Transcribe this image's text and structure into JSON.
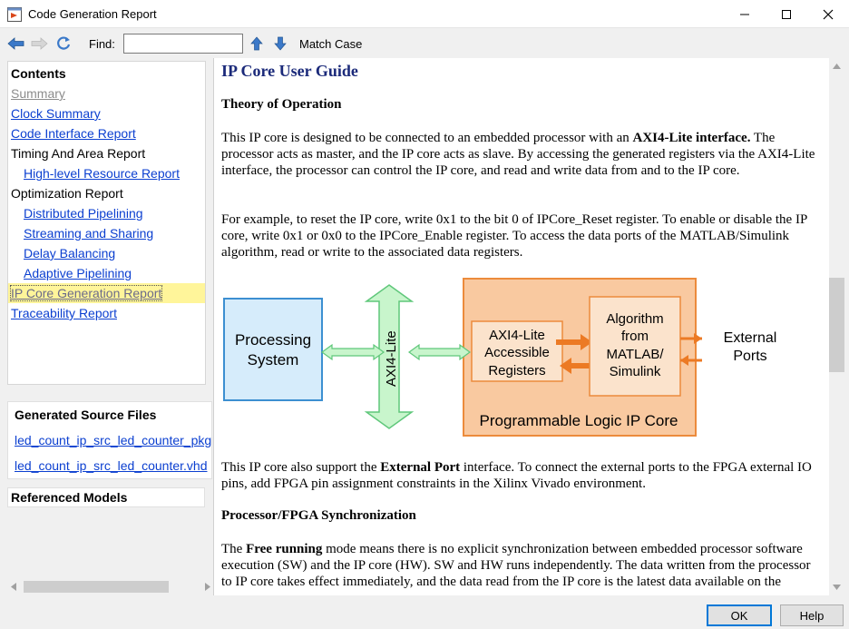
{
  "window": {
    "title": "Code Generation Report",
    "icon": "app-window-icon"
  },
  "toolbar": {
    "back_icon": "back-arrow-icon",
    "forward_icon": "forward-arrow-icon",
    "refresh_icon": "refresh-icon",
    "find_label": "Find:",
    "find_value": "",
    "find_up_icon": "arrow-up-icon",
    "find_down_icon": "arrow-down-icon",
    "match_case_label": "Match Case"
  },
  "contents": {
    "title": "Contents",
    "items": [
      {
        "label": "Summary",
        "style": "gray"
      },
      {
        "label": "Clock Summary",
        "style": "link"
      },
      {
        "label": "Code Interface Report",
        "style": "link"
      },
      {
        "label": "Timing And Area Report",
        "style": "plain"
      },
      {
        "label": "High-level Resource Report",
        "style": "link"
      },
      {
        "label": "Optimization Report",
        "style": "plain"
      },
      {
        "label": "Distributed Pipelining",
        "style": "link"
      },
      {
        "label": "Streaming and Sharing",
        "style": "link"
      },
      {
        "label": "Delay Balancing",
        "style": "link"
      },
      {
        "label": "Adaptive Pipelining",
        "style": "link"
      },
      {
        "label": "IP Core Generation Report",
        "style": "selected"
      },
      {
        "label": "Traceability Report",
        "style": "link"
      }
    ]
  },
  "generated_files": {
    "title": "Generated Source Files",
    "files": [
      "led_count_ip_src_led_counter_pkg.vhd",
      "led_count_ip_src_led_counter.vhd"
    ]
  },
  "referenced_models": {
    "title": "Referenced Models"
  },
  "document": {
    "title": "IP Core User Guide",
    "theory_heading": "Theory of Operation",
    "p1_a": "This IP core is designed to be connected to an embedded processor with an ",
    "p1_b": "AXI4-Lite interface.",
    "p1_c": " The processor acts as master, and the IP core acts as slave. By accessing the generated registers via the AXI4-Lite interface, the processor can control the IP core, and read and write data from and to the IP core.",
    "p2": "For example, to reset the IP core, write 0x1 to the bit 0 of IPCore_Reset register. To enable or disable the IP core, write 0x1 or 0x0 to the IPCore_Enable register. To access the data ports of the MATLAB/Simulink algorithm, read or write to the associated data registers.",
    "p3_a": "This IP core also support the ",
    "p3_b": "External Port",
    "p3_c": " interface. To connect the external ports to the FPGA external IO pins, add FPGA pin assignment constraints in the Xilinx Vivado environment.",
    "sync_heading": "Processor/FPGA Synchronization",
    "p4_a": "The ",
    "p4_b": "Free running",
    "p4_c": " mode means there is no explicit synchronization between embedded processor software execution (SW) and the IP core (HW). SW and HW runs independently. The data written from the processor to IP core takes effect immediately, and the data read from the IP core is the latest data available on the",
    "diagram": {
      "processing_system_line1": "Processing",
      "processing_system_line2": "System",
      "bus_label": "AXI4-Lite",
      "registers_line1": "AXI4-Lite",
      "registers_line2": "Accessible",
      "registers_line3": "Registers",
      "algorithm_line1": "Algorithm",
      "algorithm_line2": "from",
      "algorithm_line3": "MATLAB/",
      "algorithm_line4": "Simulink",
      "external_line1": "External",
      "external_line2": "Ports",
      "ip_core_label": "Programmable Logic IP Core",
      "colors": {
        "processing_fill": "#d6ecfb",
        "processing_stroke": "#3c8fd1",
        "bus_fill": "#c8f5cc",
        "bus_stroke": "#5fc77a",
        "ip_fill": "#f9c9a0",
        "ip_stroke": "#ec8b3c",
        "inner_fill": "#fbe3cc",
        "arrow_orange": "#ec7a24"
      }
    }
  },
  "buttons": {
    "ok": "OK",
    "help": "Help"
  }
}
